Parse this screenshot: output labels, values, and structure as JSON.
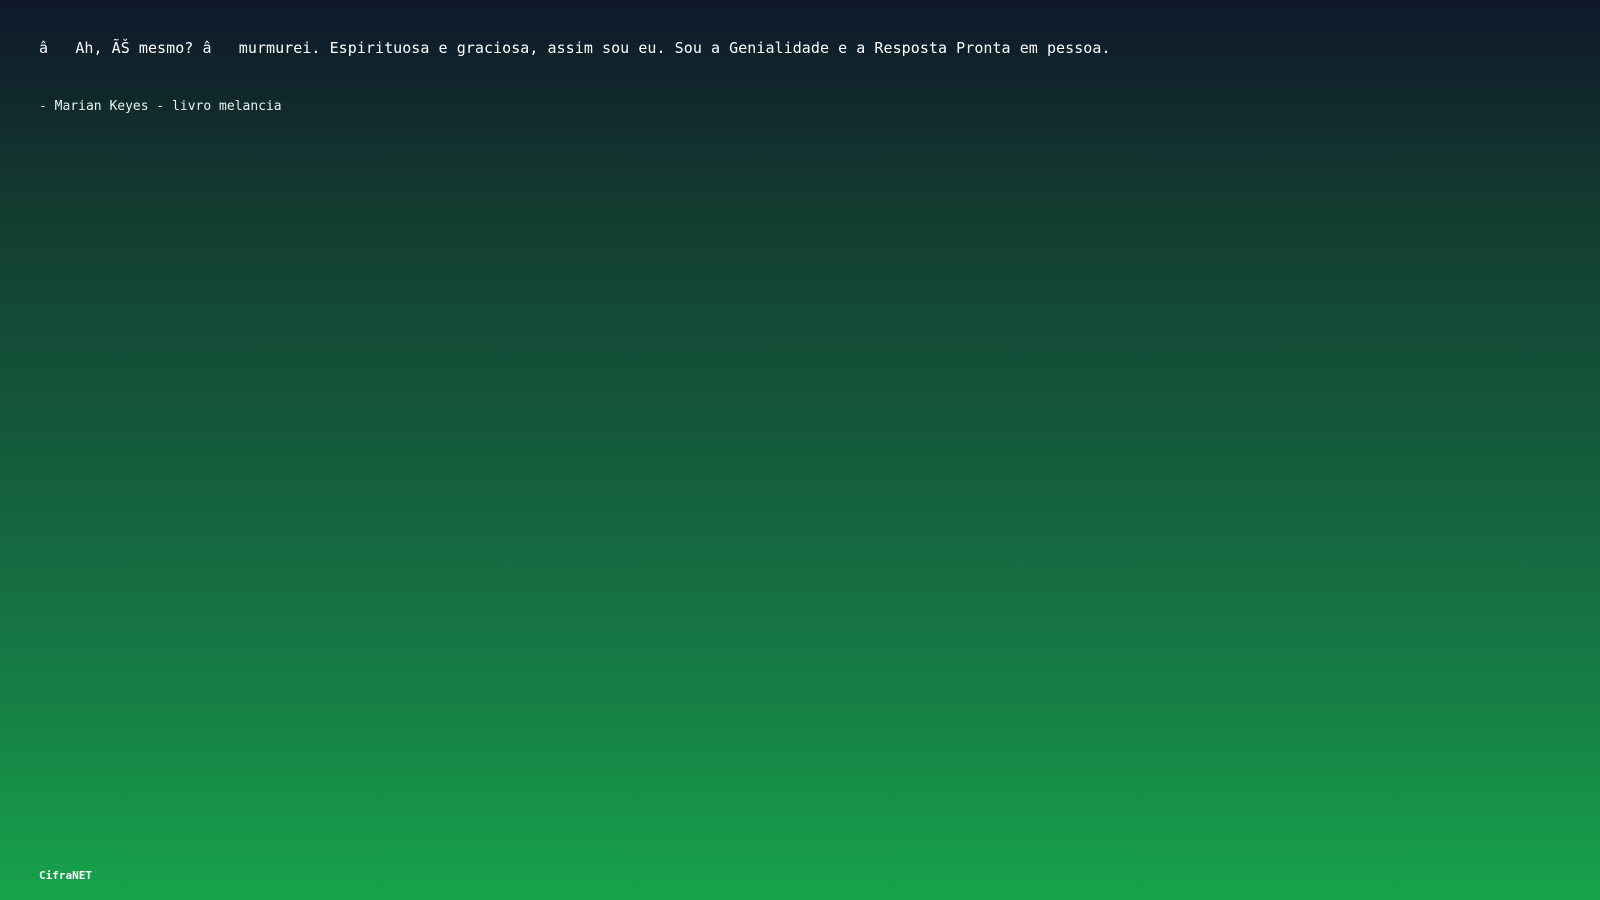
{
  "quote": {
    "text": "â   Ah, ÃŠ mesmo? â   murmurei. Espirituosa e graciosa, assim sou eu. Sou a Genialidade e a Resposta Pronta em pessoa.",
    "author": "- Marian Keyes - livro melancia"
  },
  "footer": {
    "brand": "CifraNET"
  },
  "colors": {
    "background_top": "#0f172a",
    "background_bottom": "#16a34a",
    "text": "#ffffff"
  }
}
